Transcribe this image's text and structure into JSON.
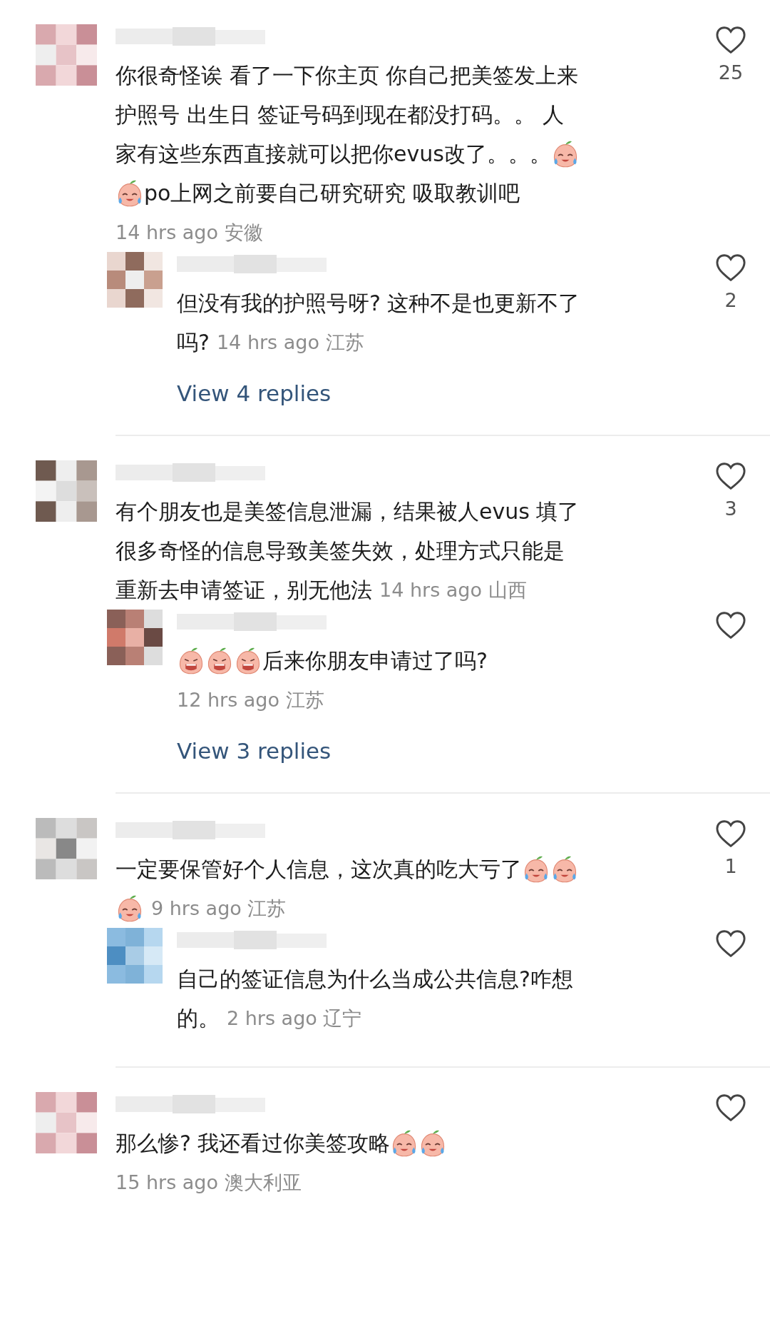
{
  "comments": [
    {
      "lines": [
        [
          {
            "kind": "text",
            "text": "你很奇怪诶 看了一下你主页 你自己把美签发上来"
          }
        ],
        [
          {
            "kind": "text",
            "text": "护照号 出生日 签证号码到现在都没打码。。 人"
          }
        ],
        [
          {
            "kind": "text",
            "text": "家有这些东西直接就可以把你evus改了。。。"
          },
          {
            "kind": "crying"
          }
        ],
        [
          {
            "kind": "crying"
          },
          {
            "kind": "text",
            "text": "po上网之前要自己研究研究  吸取教训吧"
          }
        ],
        [
          {
            "kind": "meta",
            "text": "14 hrs ago 安徽"
          }
        ]
      ],
      "likes": "25",
      "replies": [
        {
          "lines": [
            [
              {
                "kind": "text",
                "text": "但没有我的护照号呀? 这种不是也更新不了"
              }
            ],
            [
              {
                "kind": "text",
                "text": "吗?"
              },
              {
                "kind": "meta",
                "text": "14 hrs ago 江苏"
              }
            ]
          ],
          "likes": "2"
        }
      ],
      "view_replies": "View 4 replies"
    },
    {
      "lines": [
        [
          {
            "kind": "text",
            "text": "有个朋友也是美签信息泄漏，结果被人evus 填了"
          }
        ],
        [
          {
            "kind": "text",
            "text": "很多奇怪的信息导致美签失效，处理方式只能是"
          }
        ],
        [
          {
            "kind": "text",
            "text": "重新去申请签证，别无他法"
          },
          {
            "kind": "meta",
            "text": "14 hrs ago 山西"
          }
        ]
      ],
      "likes": "3",
      "replies": [
        {
          "lines": [
            [
              {
                "kind": "screaming"
              },
              {
                "kind": "screaming"
              },
              {
                "kind": "screaming"
              },
              {
                "kind": "text",
                "text": "后来你朋友申请过了吗?"
              }
            ],
            [
              {
                "kind": "meta",
                "text": "12 hrs ago 江苏"
              }
            ]
          ]
        }
      ],
      "view_replies": "View 3 replies"
    },
    {
      "lines": [
        [
          {
            "kind": "text",
            "text": "一定要保管好个人信息，这次真的吃大亏了"
          },
          {
            "kind": "crying"
          },
          {
            "kind": "crying"
          }
        ],
        [
          {
            "kind": "crying"
          },
          {
            "kind": "meta",
            "text": "9 hrs ago 江苏"
          }
        ]
      ],
      "likes": "1",
      "replies": [
        {
          "lines": [
            [
              {
                "kind": "text",
                "text": "自己的签证信息为什么当成公共信息?咋想"
              }
            ],
            [
              {
                "kind": "text",
                "text": "的。"
              },
              {
                "kind": "meta",
                "text": "2 hrs ago 辽宁"
              }
            ]
          ]
        }
      ]
    },
    {
      "lines": [
        [
          {
            "kind": "text",
            "text": "那么惨? 我还看过你美签攻略"
          },
          {
            "kind": "crying"
          },
          {
            "kind": "crying"
          }
        ],
        [
          {
            "kind": "meta",
            "text": "15 hrs ago 澳大利亚"
          }
        ]
      ]
    }
  ]
}
